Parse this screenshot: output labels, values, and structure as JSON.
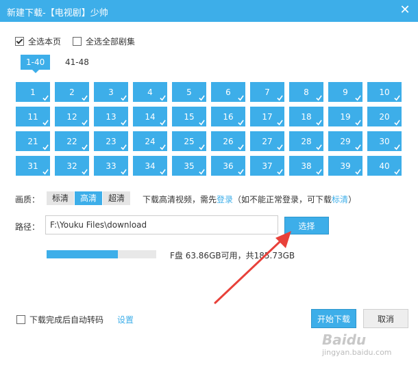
{
  "window": {
    "title": "新建下载-【电视剧】少帅",
    "close_icon": "close-icon"
  },
  "select": {
    "page_label": "全选本页",
    "all_label": "全选全部剧集",
    "page_checked": true,
    "all_checked": false
  },
  "ranges": [
    {
      "label": "1-40",
      "active": true
    },
    {
      "label": "41-48",
      "active": false
    }
  ],
  "episodes": [
    "1",
    "2",
    "3",
    "4",
    "5",
    "6",
    "7",
    "8",
    "9",
    "10",
    "11",
    "12",
    "13",
    "14",
    "15",
    "16",
    "17",
    "18",
    "19",
    "20",
    "21",
    "22",
    "23",
    "24",
    "25",
    "26",
    "27",
    "28",
    "29",
    "30",
    "31",
    "32",
    "33",
    "34",
    "35",
    "36",
    "37",
    "38",
    "39",
    "40"
  ],
  "quality": {
    "label": "画质：",
    "options": [
      {
        "label": "标清",
        "active": false
      },
      {
        "label": "高清",
        "active": true
      },
      {
        "label": "超清",
        "active": false
      }
    ],
    "note_prefix": "下载高清视频，需先",
    "note_login": "登录",
    "note_middle": "（如不能正常登录，可下载",
    "note_sd": "标清",
    "note_suffix": "）"
  },
  "path": {
    "label": "路径：",
    "value": "F:\\Youku Files\\download",
    "choose_label": "选择"
  },
  "disk": {
    "used_fraction": 0.65,
    "text": "F盘 63.86GB可用，共185.73GB"
  },
  "auto": {
    "label": "下载完成后自动转码",
    "settings_label": "设置",
    "checked": false
  },
  "actions": {
    "start_label": "开始下载",
    "cancel_label": "取消"
  },
  "watermark": {
    "logo": "Baidu",
    "site": "jingyan.baidu.com"
  },
  "colors": {
    "accent": "#3daee9",
    "annotation_arrow": "#e8413a"
  }
}
